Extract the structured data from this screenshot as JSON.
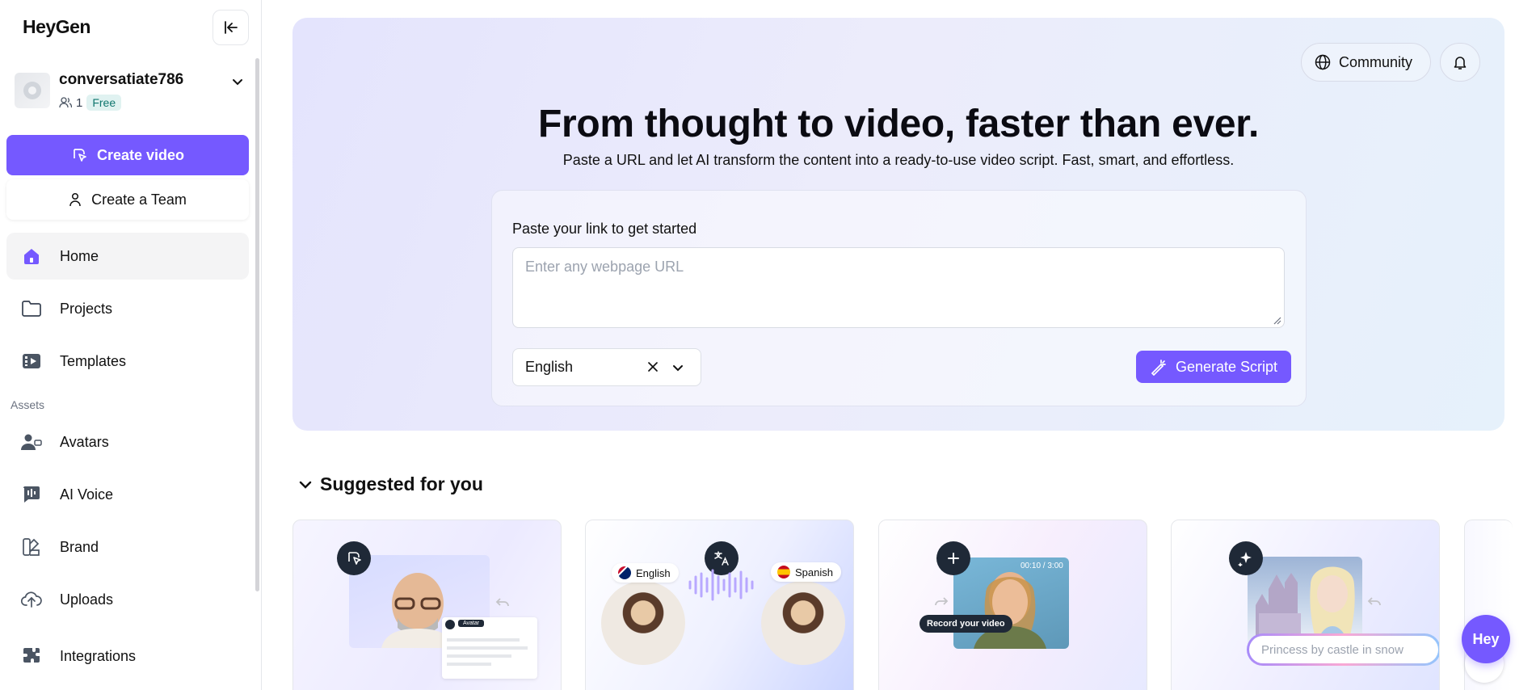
{
  "app": {
    "logo_text": "HeyGen"
  },
  "account": {
    "username": "conversatiate786",
    "member_count": "1",
    "plan": "Free"
  },
  "sidebar": {
    "create_video": "Create video",
    "create_team": "Create a Team",
    "nav": [
      {
        "label": "Home",
        "icon": "home-icon",
        "active": true
      },
      {
        "label": "Projects",
        "icon": "folder-icon"
      },
      {
        "label": "Templates",
        "icon": "templates-icon"
      }
    ],
    "assets_label": "Assets",
    "assets": [
      {
        "label": "Avatars",
        "icon": "avatar-icon"
      },
      {
        "label": "AI Voice",
        "icon": "voice-icon"
      },
      {
        "label": "Brand",
        "icon": "brand-icon"
      },
      {
        "label": "Uploads",
        "icon": "upload-icon"
      },
      {
        "label": "Integrations",
        "icon": "integrations-icon"
      }
    ]
  },
  "header": {
    "community": "Community"
  },
  "hero": {
    "title": "From thought to video, faster than ever.",
    "subtitle": "Paste a URL and let AI transform the content into a ready-to-use video script. Fast, smart, and effortless.",
    "card_label": "Paste your link to get started",
    "url_placeholder": "Enter any webpage URL",
    "language": "English",
    "generate_button": "Generate Script"
  },
  "suggested": {
    "heading": "Suggested for you",
    "tiles": [
      {
        "icon": "cursor-icon",
        "badge": "Avatar"
      },
      {
        "icon": "translate-icon",
        "from_lang": "English",
        "to_lang": "Spanish"
      },
      {
        "icon": "plus-icon",
        "timer": "00:10 / 3:00",
        "label": "Record your video"
      },
      {
        "icon": "sparkle-icon",
        "prompt": "Princess by castle in snow"
      }
    ]
  },
  "assistant": {
    "label": "Hey"
  },
  "colors": {
    "accent": "#7559ff",
    "hero_bg_start": "#e4e4fd",
    "hero_bg_end": "#e6f1fb"
  }
}
